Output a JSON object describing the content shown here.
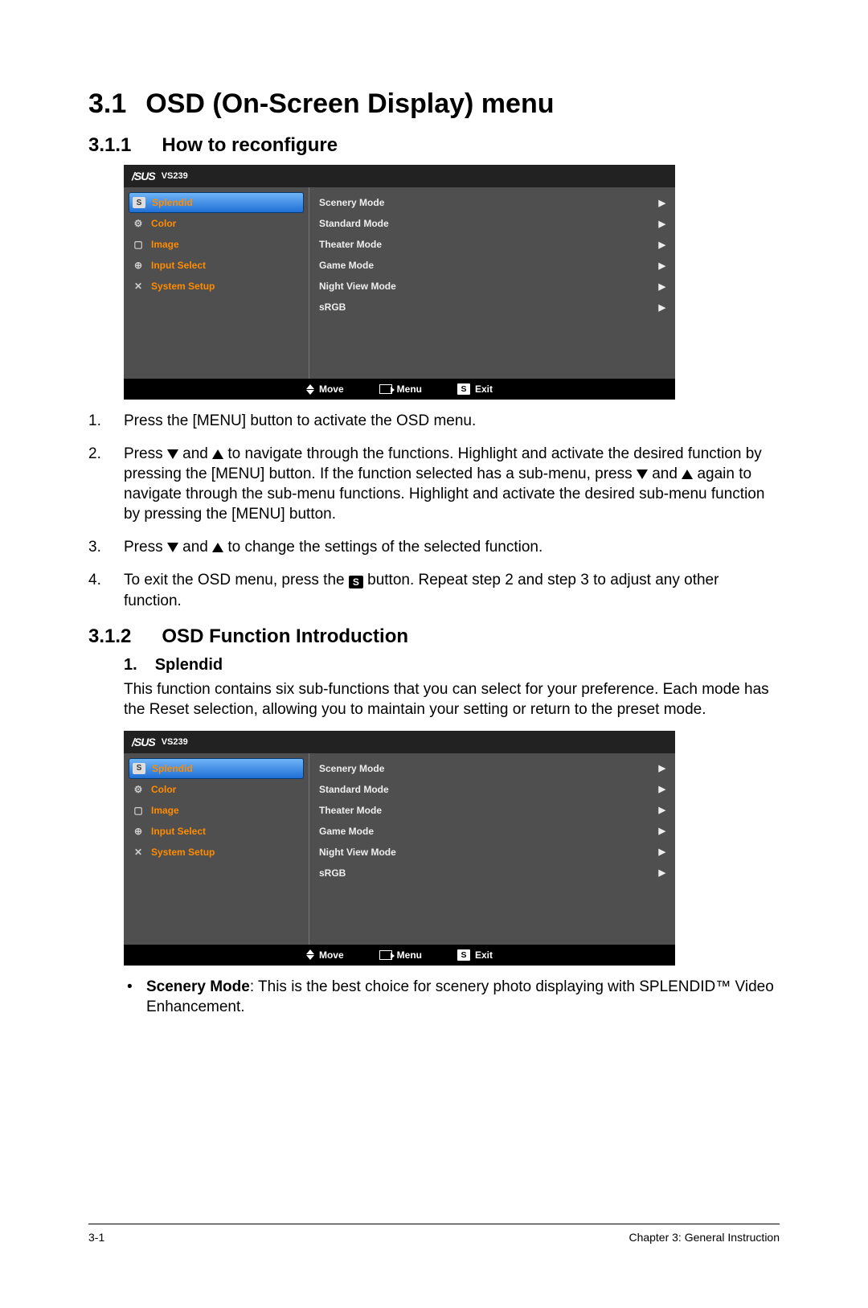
{
  "headings": {
    "h1_num": "3.1",
    "h1_title": "OSD (On-Screen Display) menu",
    "h2a_num": "3.1.1",
    "h2a_title": "How to reconfigure",
    "h2b_num": "3.1.2",
    "h2b_title": "OSD Function Introduction",
    "h3_num": "1.",
    "h3_title": "Splendid"
  },
  "osd": {
    "brand": "/SUS",
    "model": "VS239",
    "left_items": [
      "Splendid",
      "Color",
      "Image",
      "Input Select",
      "System Setup"
    ],
    "right_items": [
      "Scenery Mode",
      "Standard Mode",
      "Theater Mode",
      "Game Mode",
      "Night View Mode",
      "sRGB"
    ],
    "footer": {
      "move": "Move",
      "menu": "Menu",
      "exit": "Exit"
    }
  },
  "steps": {
    "s1": "Press the [MENU] button to activate the OSD menu.",
    "s2a": "Press ",
    "s2b": " and ",
    "s2c": " to navigate through the functions. Highlight and activate the desired function by pressing the [MENU] button. If the function selected has a sub-menu, press ",
    "s2d": " and ",
    "s2e": " again to navigate through the sub-menu functions. Highlight and activate the desired sub-menu function by pressing the [MENU] button.",
    "s3a": "Press ",
    "s3b": " and ",
    "s3c": " to change the settings of the selected function.",
    "s4a": "To exit the OSD menu, press the ",
    "s4b": " button. Repeat step 2 and step 3 to adjust any other function."
  },
  "splendid_intro": "This function contains six sub-functions that you can select for your preference. Each mode has the Reset selection, allowing you to maintain your setting or return to the preset mode.",
  "bullets": {
    "scenery_label": "Scenery Mode",
    "scenery_text": ": This is the best choice for scenery photo displaying with SPLENDID™ Video Enhancement."
  },
  "footer": {
    "page": "3-1",
    "chapter": "Chapter 3: General Instruction"
  }
}
